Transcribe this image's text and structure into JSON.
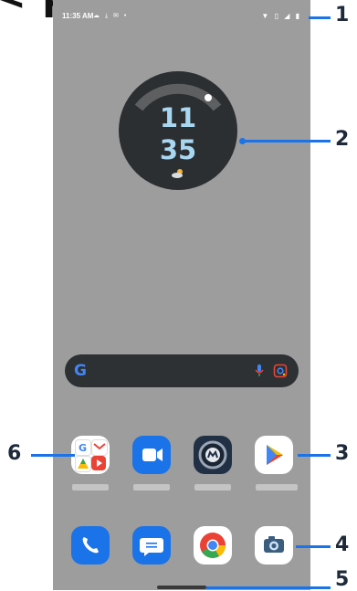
{
  "page_heading_fragment": "< pp",
  "status_bar": {
    "time": "11:35 AM",
    "left_icons": [
      "cloud-icon",
      "download-icon",
      "notification-icon"
    ],
    "right_icons": [
      "wifi-icon",
      "vibrate-icon",
      "signal-icon",
      "battery-icon"
    ]
  },
  "clock": {
    "hours": "11",
    "minutes": "35",
    "weather_icon": "partly-cloudy-icon"
  },
  "search_bar": {
    "logo": "G",
    "icons": [
      "mic-icon",
      "lens-icon"
    ]
  },
  "apps_row": [
    {
      "name": "google-folder"
    },
    {
      "name": "duo-video"
    },
    {
      "name": "moto-app"
    },
    {
      "name": "play-store"
    }
  ],
  "dock": [
    {
      "name": "phone"
    },
    {
      "name": "messages"
    },
    {
      "name": "chrome"
    },
    {
      "name": "camera"
    }
  ],
  "callouts": [
    "1",
    "2",
    "3",
    "4",
    "5",
    "6"
  ],
  "colors": {
    "accent": "#1a73e8",
    "wallpaper": "#9d9d9d",
    "clock_bg": "#2b2f31",
    "clock_text": "#a9d7f2"
  }
}
